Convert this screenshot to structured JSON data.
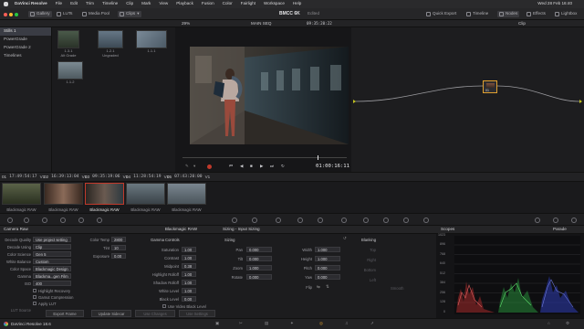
{
  "menubar": {
    "apple": "",
    "items": [
      "DaVinci Resolve",
      "File",
      "Edit",
      "Trim",
      "Timeline",
      "Clip",
      "Mark",
      "View",
      "Playback",
      "Fusion",
      "Color",
      "Fairlight",
      "Workspace",
      "Help"
    ],
    "clock": "Wed 28 Feb 16:40"
  },
  "toolbar": {
    "gallery": "Gallery",
    "luts": "LUTs",
    "media_pool": "Media Pool",
    "clips": "Clips",
    "project_title": "BMCC 6K",
    "project_status": "Edited",
    "quick_export": "Quick Export",
    "timeline": "Timeline",
    "nodes": "Nodes",
    "effects": "Effects",
    "lightbox": "Lightbox"
  },
  "viewer": {
    "zoom": "29%",
    "timeline_name": "MAIN SEQ",
    "timecode_top": "09:35:20:22",
    "timecode": "01:00:16:11",
    "clip_label": "Clip"
  },
  "gallery": {
    "albums": [
      {
        "label": "Stills 1",
        "selected": true
      },
      {
        "label": "PowerGrade",
        "selected": false
      },
      {
        "label": "PowerGrade 2",
        "selected": false
      },
      {
        "label": "Timelines",
        "selected": false
      }
    ],
    "stills": [
      {
        "label": "1.3.1",
        "sub": "Alt Grade"
      },
      {
        "label": "1.2.1",
        "sub": "Ungraded"
      },
      {
        "label": "1.1.1",
        "sub": ""
      },
      {
        "label": "1.1.2",
        "sub": ""
      }
    ]
  },
  "clips": [
    {
      "num": "01",
      "tc": "17:49:54:17",
      "track": "V1",
      "label": "Blackmagic RAW",
      "selected": false
    },
    {
      "num": "02",
      "tc": "16:39:13:04",
      "track": "V1",
      "label": "Blackmagic RAW",
      "selected": false
    },
    {
      "num": "03",
      "tc": "09:35:19:06",
      "track": "V1",
      "label": "Blackmagic RAW",
      "selected": true
    },
    {
      "num": "04",
      "tc": "11:28:54:19",
      "track": "V1",
      "label": "Blackmagic RAW",
      "selected": false
    },
    {
      "num": "05",
      "tc": "07:43:20:00",
      "track": "V1",
      "label": "Blackmagic RAW",
      "selected": false
    }
  ],
  "camera_raw": {
    "title": "Camera Raw",
    "decode_quality_label": "Decode Quality",
    "decode_quality": "Use project setting",
    "decode_using_label": "Decode Using",
    "decode_using": "Clip",
    "color_science_label": "Color Science",
    "color_science": "Gen 5",
    "white_balance_label": "White Balance",
    "white_balance": "Custom",
    "color_space_label": "Color Space",
    "color_space": "Blackmagic Design",
    "gamma_label": "Gamma",
    "gamma": "Blackma...gen Film",
    "iso_label": "ISO",
    "iso": "400",
    "color_temp_label": "Color Temp",
    "color_temp": "2800",
    "tint_label": "Tint",
    "tint": "10",
    "exposure_label": "Exposure",
    "exposure": "0.00",
    "highlight_recovery": "Highlight Recovery",
    "gamut_compression": "Gamut Compression",
    "apply_lut": "Apply LUT",
    "lut_source_label": "LUT Source",
    "export_frame": "Export Frame",
    "update_sidecar": "Update Sidecar",
    "use_changes": "Use Changes",
    "use_settings": "Use Settings"
  },
  "gamma_controls": {
    "panel_title": "Blackmagic RAW",
    "title": "Gamma Controls",
    "rows": [
      {
        "label": "Saturation",
        "value": "1.00"
      },
      {
        "label": "Contrast",
        "value": "1.00"
      },
      {
        "label": "Midpoint",
        "value": "0.38"
      },
      {
        "label": "Highlight Rolloff",
        "value": "1.00"
      },
      {
        "label": "Shadow Rolloff",
        "value": "1.00"
      },
      {
        "label": "White Level",
        "value": "1.00"
      },
      {
        "label": "Black Level",
        "value": "0.00"
      }
    ],
    "video_black": "Use Video Black Level"
  },
  "sizing": {
    "panel_title": "Sizing - Input Sizing",
    "title": "Sizing",
    "left": [
      {
        "label": "Pan",
        "value": "0.000"
      },
      {
        "label": "Tilt",
        "value": "0.000"
      },
      {
        "label": "Zoom",
        "value": "1.000"
      },
      {
        "label": "Rotate",
        "value": "0.000"
      }
    ],
    "right": [
      {
        "label": "Width",
        "value": "1.000"
      },
      {
        "label": "Height",
        "value": "1.000"
      },
      {
        "label": "Pitch",
        "value": "0.000"
      },
      {
        "label": "Yaw",
        "value": "0.000"
      }
    ],
    "flip": "Flip"
  },
  "blanking": {
    "title": "Blanking",
    "rows": [
      "Top",
      "Right",
      "Bottom",
      "Left"
    ],
    "smooth": "Smooth"
  },
  "scopes": {
    "title": "Scopes",
    "mode": "Parade",
    "ticks": [
      "1023",
      "896",
      "768",
      "640",
      "512",
      "384",
      "256",
      "128",
      "0"
    ]
  },
  "bottombar": {
    "app": "DaVinci Resolve 18.6"
  },
  "colors": {
    "accent_red": "#c0392b",
    "accent_orange": "#e0a030",
    "selected": "#3a3c44"
  }
}
